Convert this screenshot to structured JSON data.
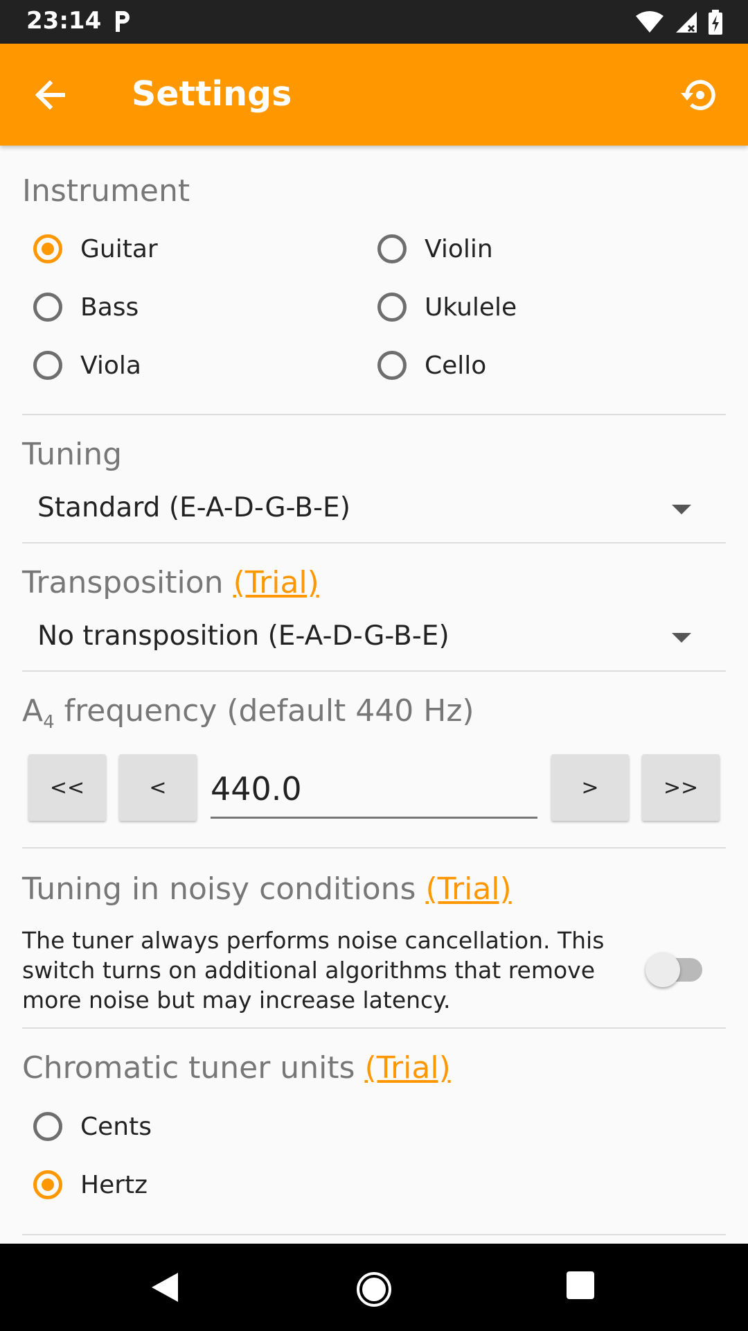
{
  "statusbar": {
    "time": "23:14",
    "icons": [
      "parking-icon",
      "wifi-icon",
      "cell-signal-icon",
      "battery-charging-icon"
    ]
  },
  "appbar": {
    "title": "Settings",
    "back_icon": "arrow-left-icon",
    "reset_icon": "restore-icon",
    "color": "#ff9800"
  },
  "instrument": {
    "title": "Instrument",
    "options": [
      {
        "label": "Guitar",
        "checked": true
      },
      {
        "label": "Violin",
        "checked": false
      },
      {
        "label": "Bass",
        "checked": false
      },
      {
        "label": "Ukulele",
        "checked": false
      },
      {
        "label": "Viola",
        "checked": false
      },
      {
        "label": "Cello",
        "checked": false
      }
    ]
  },
  "tuning": {
    "title": "Tuning",
    "value": "Standard (E-A-D-G-B-E)"
  },
  "transposition": {
    "title": "Transposition",
    "trial": "(Trial)",
    "value": "No transposition (E-A-D-G-B-E)"
  },
  "frequency": {
    "title_prefix": "A",
    "title_sub": "4",
    "title_rest": " frequency (default 440 Hz)",
    "buttons": [
      "<<",
      "<",
      ">",
      ">>"
    ],
    "value": "440.0"
  },
  "noisy": {
    "title": "Tuning in noisy conditions",
    "trial": "(Trial)",
    "description": "The tuner always performs noise cancellation. This switch turns on additional algorithms that remove more noise but may increase latency.",
    "enabled": false
  },
  "chromatic": {
    "title": "Chromatic tuner units",
    "trial": "(Trial)",
    "options": [
      {
        "label": "Cents",
        "checked": false
      },
      {
        "label": "Hertz",
        "checked": true
      }
    ]
  },
  "navbar": {
    "icons": [
      "back-triangle-icon",
      "home-circle-icon",
      "recents-square-icon"
    ]
  }
}
